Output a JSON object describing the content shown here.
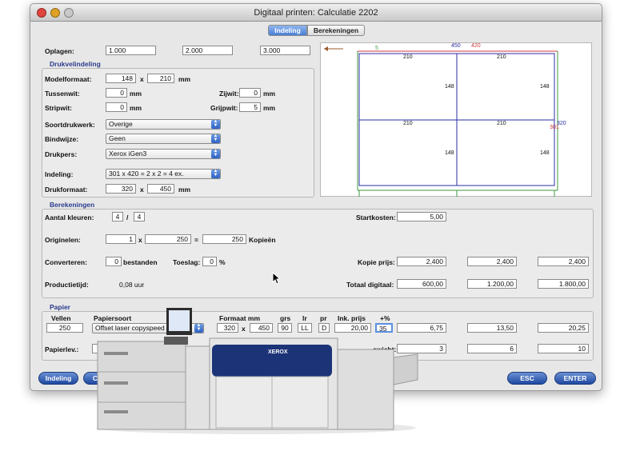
{
  "window": {
    "title": "Digitaal printen: Calculatie 2202"
  },
  "tabs": [
    {
      "label": "Indeling",
      "active": true
    },
    {
      "label": "Berekeningen",
      "active": false
    }
  ],
  "oplagen": {
    "label": "Oplagen:",
    "values": [
      "1.000",
      "2.000",
      "3.000"
    ]
  },
  "drukvel": {
    "title": "Drukvelindeling",
    "modelformaat": {
      "label": "Modelformaat:",
      "w": "148",
      "x": "x",
      "h": "210",
      "unit": "mm"
    },
    "tussenwit": {
      "label": "Tussenwit:",
      "value": "0",
      "unit": "mm"
    },
    "zijwit": {
      "label": "Zijwit:",
      "value": "0",
      "unit": "mm"
    },
    "stripwit": {
      "label": "Stripwit:",
      "value": "0",
      "unit": "mm"
    },
    "grijpwit": {
      "label": "Grijpwit:",
      "value": "5",
      "unit": "mm"
    },
    "soortdrukwerk": {
      "label": "Soortdrukwerk:",
      "value": "Overige"
    },
    "bindwijze": {
      "label": "Bindwijze:",
      "value": "Geen"
    },
    "drukpers": {
      "label": "Drukpers:",
      "value": "Xerox iGen3"
    },
    "indeling": {
      "label": "Indeling:",
      "value": "301 x 420 = 2 x 2 = 4 ex."
    },
    "drukformaat": {
      "label": "Drukformaat:",
      "w": "320",
      "x": "x",
      "h": "450",
      "unit": "mm"
    }
  },
  "preview": {
    "top_labels": {
      "left_margin": "5",
      "width_total": "450",
      "width_used": "420"
    },
    "cells": [
      {
        "w": "210",
        "h": "148"
      },
      {
        "w": "210",
        "h": "148"
      },
      {
        "w": "210",
        "h": "148"
      },
      {
        "w": "210",
        "h": "148"
      }
    ],
    "right_labels": {
      "h_total": "320",
      "h_used": "301"
    },
    "colors": {
      "sheet": "#2b2fa8",
      "used": "#d13a3a",
      "fold": "#3f9a3f",
      "arrow": "#9a5a2a"
    }
  },
  "berekeningen": {
    "title": "Berekeningen",
    "kleuren": {
      "label": "Aantal kleuren:",
      "a": "4",
      "sep": "/",
      "b": "4"
    },
    "originelen": {
      "label": "Originelen:",
      "a": "1",
      "x": "x",
      "b": "250",
      "eq": "=",
      "total": "250",
      "suffix": "Kopieën"
    },
    "converteren": {
      "label": "Converteren:",
      "value": "0",
      "suffix": "bestanden"
    },
    "toeslag": {
      "label": "Toeslag:",
      "value": "0",
      "suffix": "%"
    },
    "productietijd": {
      "label": "Productietijd:",
      "value": "0,08 uur"
    },
    "startkosten": {
      "label": "Startkosten:",
      "value": "5,00"
    },
    "kopieprijs": {
      "label": "Kopie prijs:",
      "values": [
        "2,400",
        "2,400",
        "2,400"
      ]
    },
    "totaal": {
      "label": "Totaal digitaal:",
      "values": [
        "600,00",
        "1.200,00",
        "1.800,00"
      ]
    }
  },
  "papier": {
    "title": "Papier",
    "headers": {
      "vellen": "Vellen",
      "papiersoort": "Papiersoort",
      "formaat": "Formaat mm",
      "grs": "grs",
      "lr": "lr",
      "pr": "pr",
      "inkprijs": "Ink. prijs",
      "pct": "+%"
    },
    "row": {
      "vellen": "250",
      "papiersoort": "Offset laser copyspeed",
      "f_w": "320",
      "f_x": "x",
      "f_h": "450",
      "grs": "90",
      "lr": "LL",
      "pr": "D",
      "inkprijs": "20,00",
      "pct": "35"
    },
    "prices": [
      "6,75",
      "13,50",
      "20,25"
    ],
    "papierlev": {
      "label": "Papierlev.:"
    },
    "gewicht": {
      "label": "ewicht:",
      "values": [
        "3",
        "6",
        "10"
      ]
    }
  },
  "buttons": {
    "indeling": "Indeling",
    "partial": "C",
    "esc": "ESC",
    "enter": "ENTER"
  },
  "printer": {
    "brand": "XEROX"
  }
}
